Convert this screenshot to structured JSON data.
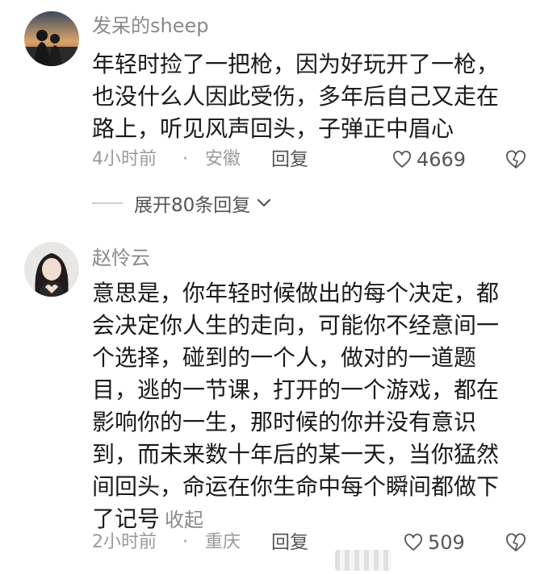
{
  "comments": [
    {
      "username": "发呆的sheep",
      "lines": [
        "年轻时捡了一把枪，因为好玩开了一枪，",
        "也没什么人因此受伤，多年后自己又走在",
        "路上，听见风声回头，子弹正中眉心"
      ],
      "time": "4小时前",
      "separator": "·",
      "location": "安徽",
      "reply_label": "回复",
      "likes": "4669"
    },
    {
      "username": "赵怜云",
      "lines": [
        "意思是，你年轻时候做出的每个决定，都",
        "会决定你人生的走向，可能你不经意间一",
        "个选择，碰到的一个人，做对的一道题",
        "目，逃的一节课，打开的一个游戏，都在",
        "影响你的一生，那时候的你并没有意识",
        "到，而未来数十年后的某一天，当你猛然",
        "间回头，命运在你生命中每个瞬间都做下",
        "了记号"
      ],
      "collapse_label": "收起",
      "time": "2小时前",
      "separator": "·",
      "location": "重庆",
      "reply_label": "回复",
      "likes": "509"
    }
  ],
  "expand_replies_label": "展开80条回复",
  "icons": {
    "like": "heart-icon",
    "dislike": "broken-heart-icon",
    "expand": "chevron-down-icon"
  }
}
